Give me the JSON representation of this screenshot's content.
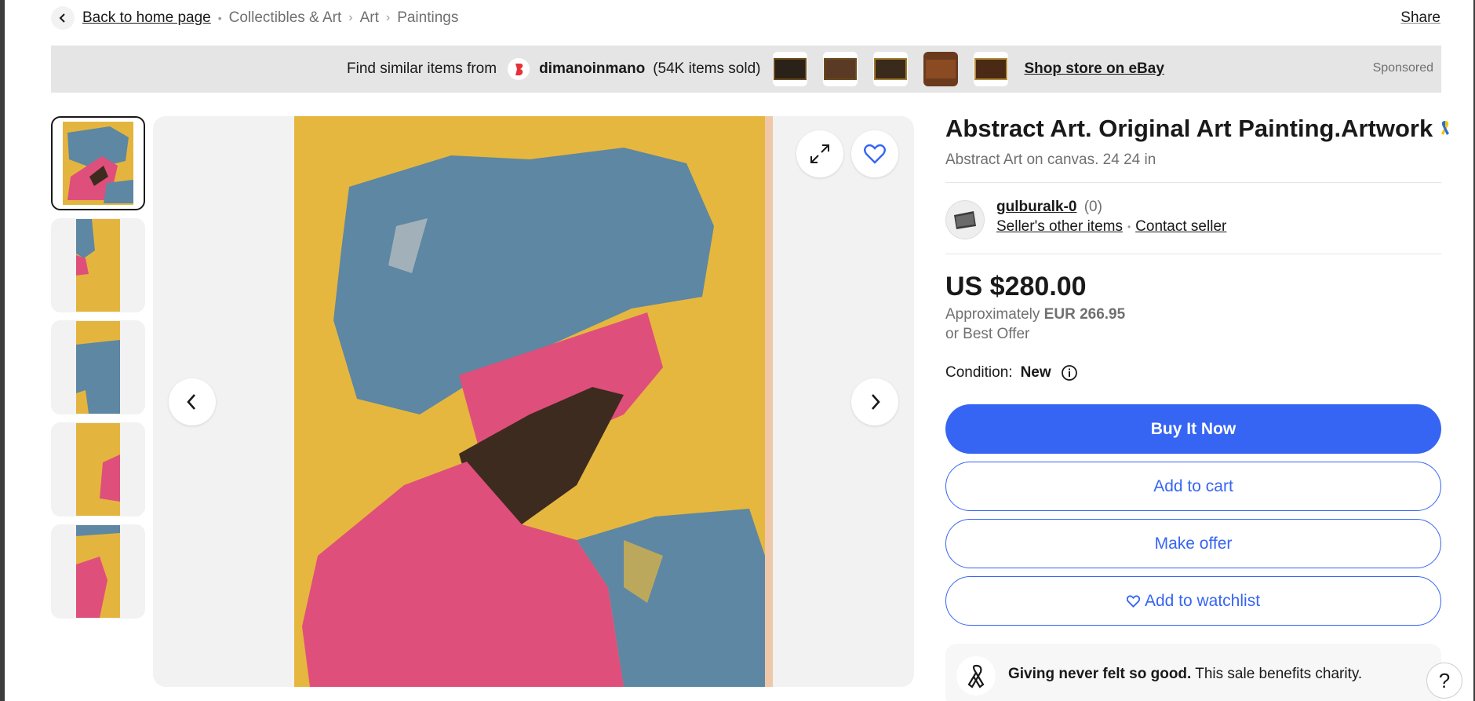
{
  "breadcrumb": {
    "back_label": "Back to home page",
    "crumbs": [
      "Collectibles & Art",
      "Art",
      "Paintings"
    ]
  },
  "share_label": "Share",
  "store_banner": {
    "find_text": "Find similar items from",
    "store_name": "dimanoinmano",
    "items_sold": "(54K items sold)",
    "shop_link": "Shop store on eBay",
    "sponsored": "Sponsored"
  },
  "listing": {
    "title": "Abstract Art. Original Art Painting.Artwork",
    "subtitle": "Abstract Art on canvas. 24 24 in"
  },
  "seller": {
    "name": "gulburalk-0",
    "score": "(0)",
    "other_items": "Seller's other items",
    "contact": "Contact seller"
  },
  "pricing": {
    "price": "US $280.00",
    "approx_prefix": "Approximately",
    "approx_value": "EUR 266.95",
    "best_offer": "or Best Offer"
  },
  "condition": {
    "label": "Condition:",
    "value": "New"
  },
  "actions": {
    "buy_now": "Buy It Now",
    "add_to_cart": "Add to cart",
    "make_offer": "Make offer",
    "add_to_watchlist": "Add to watchlist"
  },
  "charity": {
    "bold": "Giving never felt so good.",
    "text": "This sale benefits charity."
  },
  "help_label": "?",
  "colors": {
    "accent": "#3665f3",
    "painting_yellow": "#e6b73e",
    "painting_blue": "#5d87a3",
    "painting_pink": "#df4f7b",
    "painting_brown": "#3d2b1f"
  },
  "icons": [
    "chevron-left-icon",
    "chevron-right-icon",
    "expand-icon",
    "heart-icon",
    "info-icon",
    "ribbon-icon",
    "store-logo-icon"
  ]
}
